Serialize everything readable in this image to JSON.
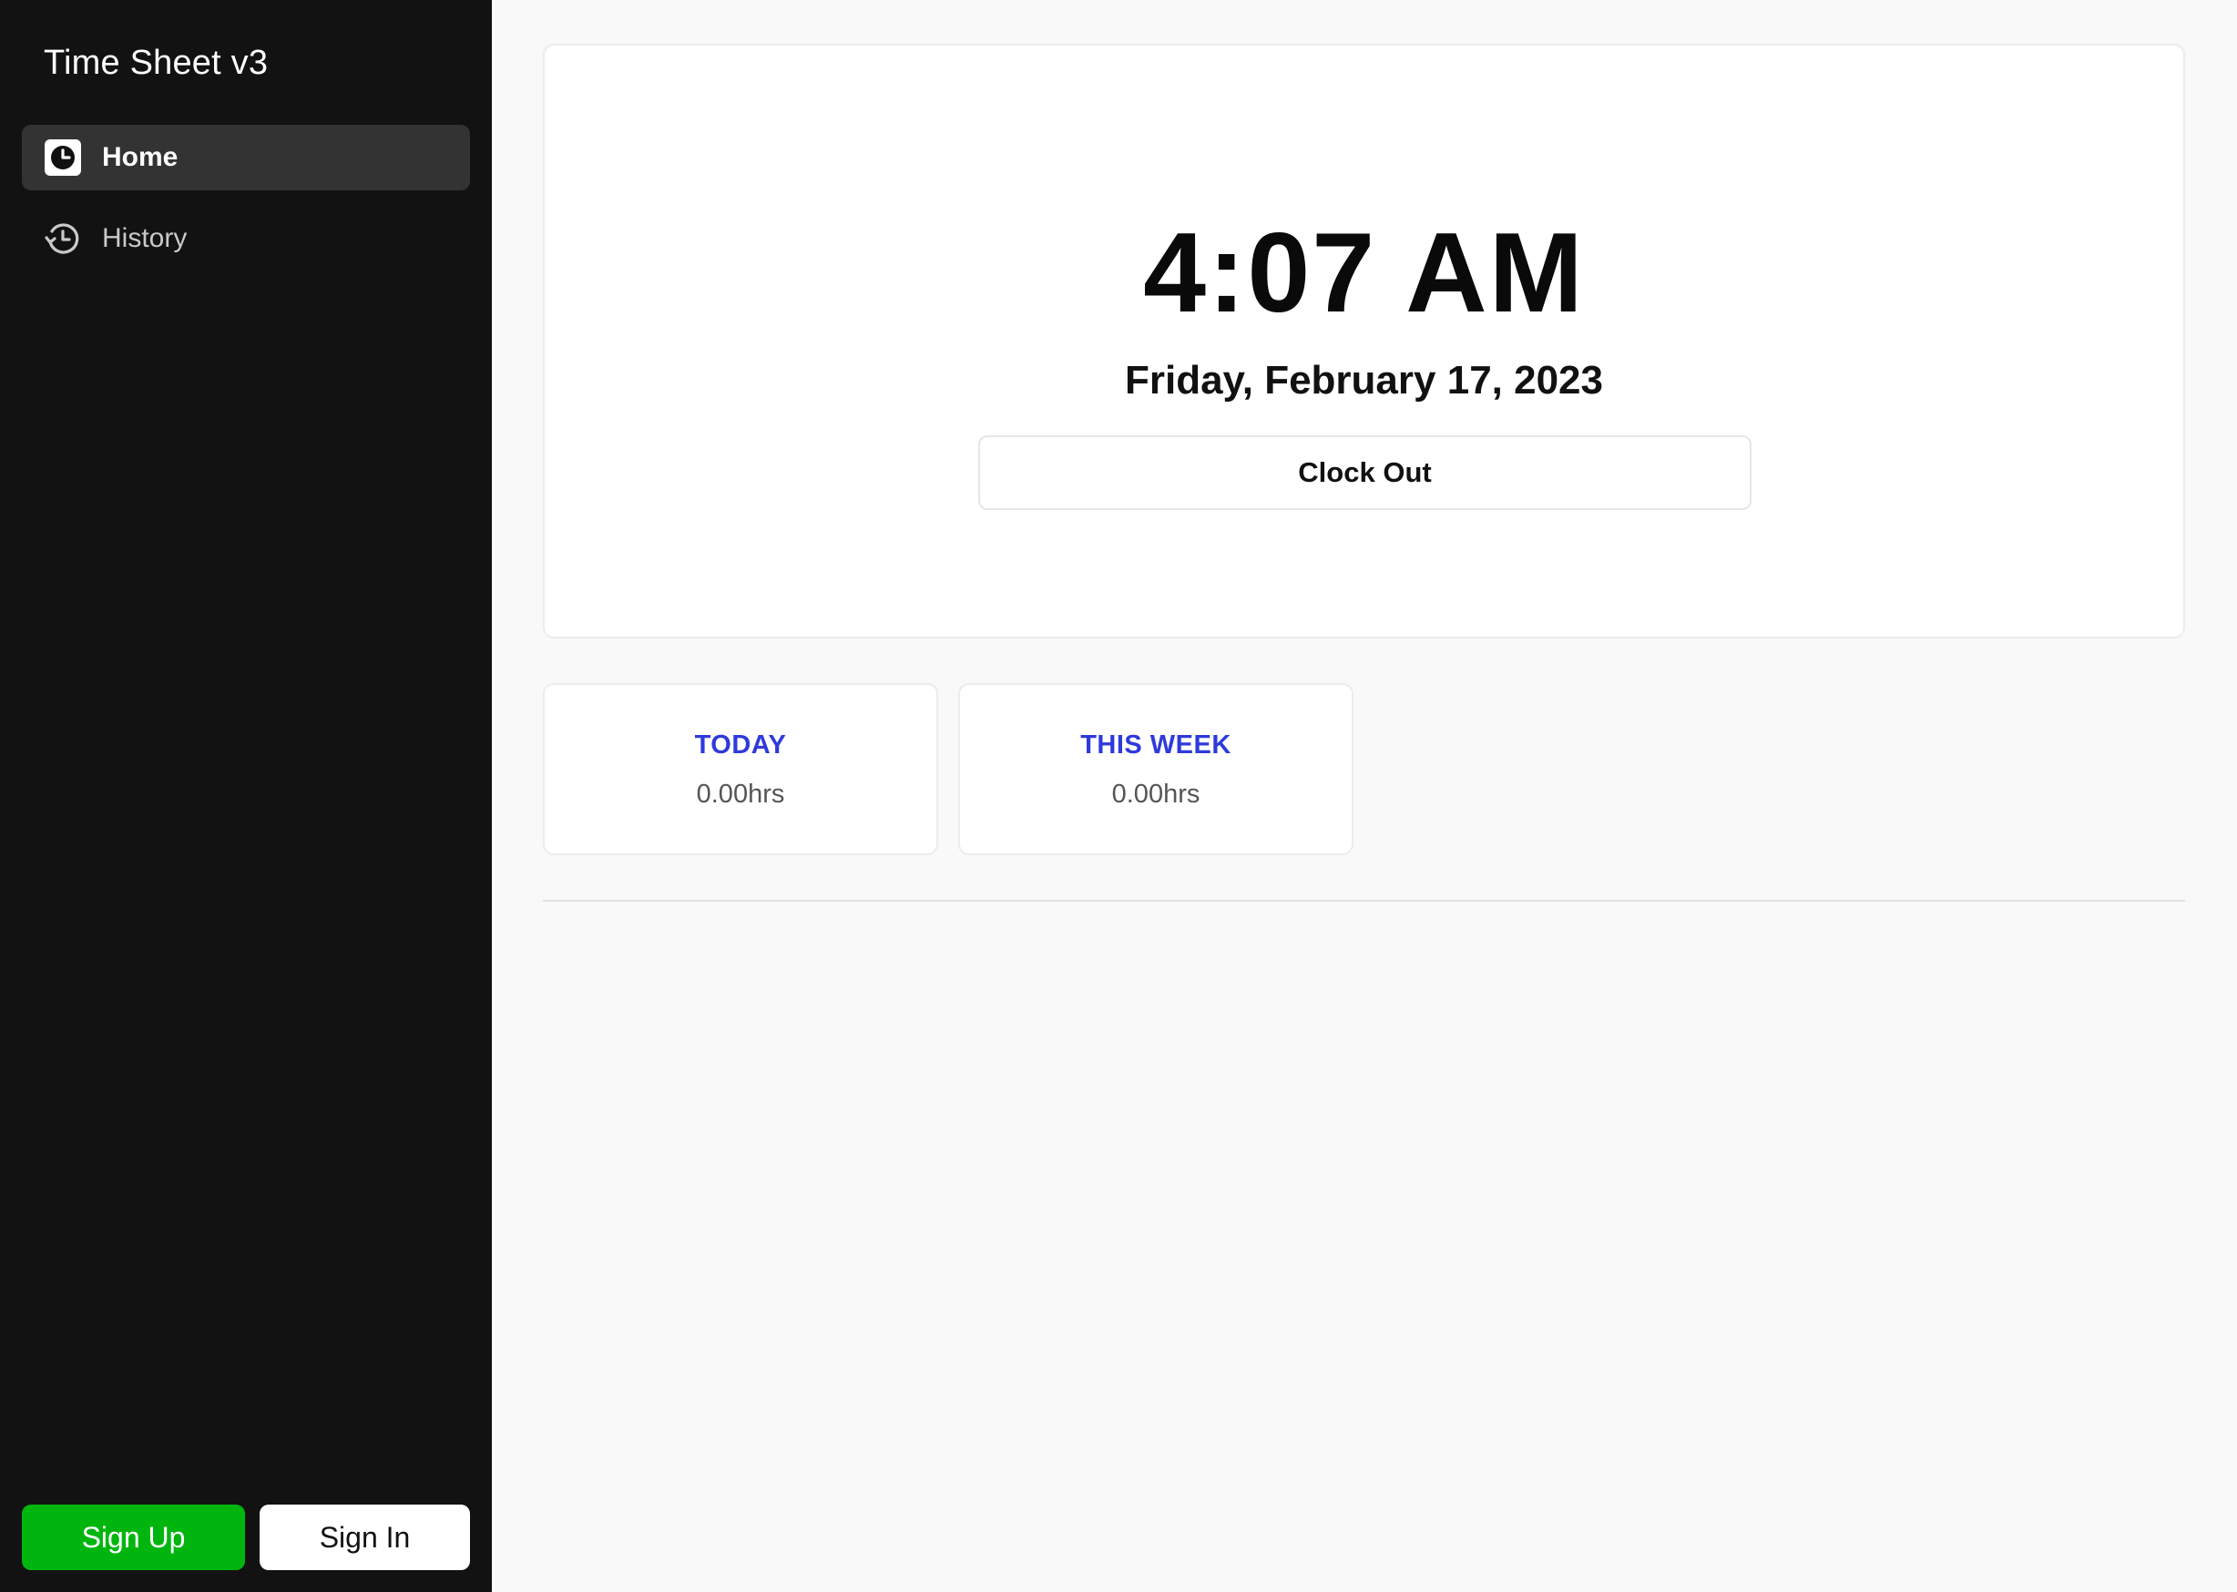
{
  "sidebar": {
    "title": "Time Sheet v3",
    "items": [
      {
        "label": "Home",
        "icon": "clock-icon",
        "active": true
      },
      {
        "label": "History",
        "icon": "history-icon",
        "active": false
      }
    ],
    "sign_up_label": "Sign Up",
    "sign_in_label": "Sign In"
  },
  "clock": {
    "time": "4:07 AM",
    "date": "Friday, February 17, 2023",
    "button_label": "Clock Out"
  },
  "stats": [
    {
      "label": "TODAY",
      "value": "0.00hrs"
    },
    {
      "label": "THIS WEEK",
      "value": "0.00hrs"
    }
  ],
  "colors": {
    "sidebar_bg": "#121212",
    "active_item_bg": "#333333",
    "sign_up_green": "#00b60e",
    "stat_label_blue": "#2e3adb",
    "main_bg": "#f9f9f9"
  }
}
